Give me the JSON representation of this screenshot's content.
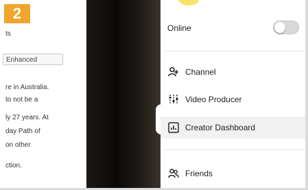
{
  "step_badge": "2",
  "article": {
    "lines_top": [
      "ts"
    ],
    "enhanced_label": "Enhanced",
    "lines": [
      "re in Australia.",
      "to not be a",
      "ly 27 years. At",
      "day Path of",
      "on other",
      "ction."
    ]
  },
  "menu": {
    "online_label": "Online",
    "online_enabled": false,
    "items": [
      {
        "label": "Channel",
        "icon": "person-add-icon"
      },
      {
        "label": "Video Producer",
        "icon": "equalizer-icon"
      },
      {
        "label": "Creator Dashboard",
        "icon": "dashboard-chart-icon",
        "highlighted": true
      }
    ],
    "friends_label": "Friends",
    "friends_icon": "friends-icon"
  },
  "colors": {
    "badge": "#f0a62c",
    "highlight_row": "#f1f1f1",
    "toggle_off": "#d9d9d9"
  }
}
